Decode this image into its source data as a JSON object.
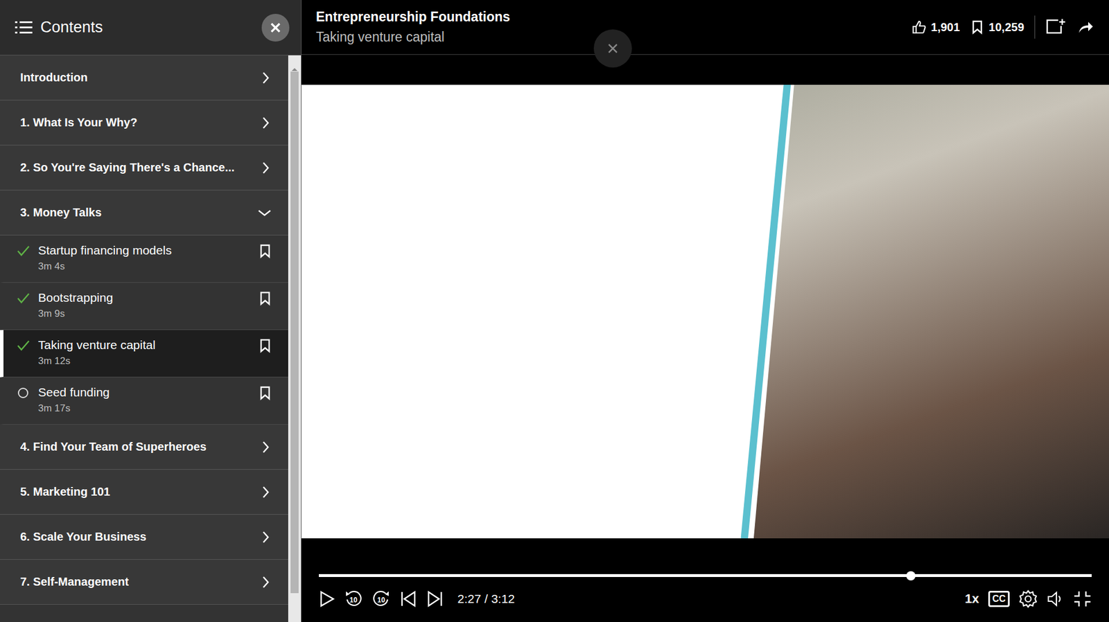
{
  "sidebar": {
    "title": "Contents",
    "scrollbar": {
      "level": 0.96
    },
    "sections": [
      {
        "label": "Introduction",
        "expanded": false,
        "lessons": []
      },
      {
        "label": "1. What Is Your Why?",
        "expanded": false,
        "lessons": []
      },
      {
        "label": "2. So You're Saying There's a Chance...",
        "expanded": false,
        "lessons": []
      },
      {
        "label": "3. Money Talks",
        "expanded": true,
        "lessons": [
          {
            "title": "Startup financing models",
            "duration": "3m 4s",
            "completed": true,
            "selected": false
          },
          {
            "title": "Bootstrapping",
            "duration": "3m 9s",
            "completed": true,
            "selected": false
          },
          {
            "title": "Taking venture capital",
            "duration": "3m 12s",
            "completed": true,
            "selected": true
          },
          {
            "title": "Seed funding",
            "duration": "3m 17s",
            "completed": false,
            "selected": false
          }
        ]
      },
      {
        "label": "4. Find Your Team of Superheroes",
        "expanded": false,
        "lessons": []
      },
      {
        "label": "5. Marketing 101",
        "expanded": false,
        "lessons": []
      },
      {
        "label": "6. Scale Your Business",
        "expanded": false,
        "lessons": []
      },
      {
        "label": "7. Self-Management",
        "expanded": false,
        "lessons": []
      }
    ]
  },
  "header": {
    "course": "Entrepreneurship Foundations",
    "video": "Taking venture capital",
    "likes": "1,901",
    "saves": "10,259"
  },
  "player": {
    "playing": false,
    "rewind": "10",
    "forward": "10",
    "time": "2:27 / 3:12",
    "level": 0.766,
    "speed": "1x",
    "captions": "CC"
  }
}
